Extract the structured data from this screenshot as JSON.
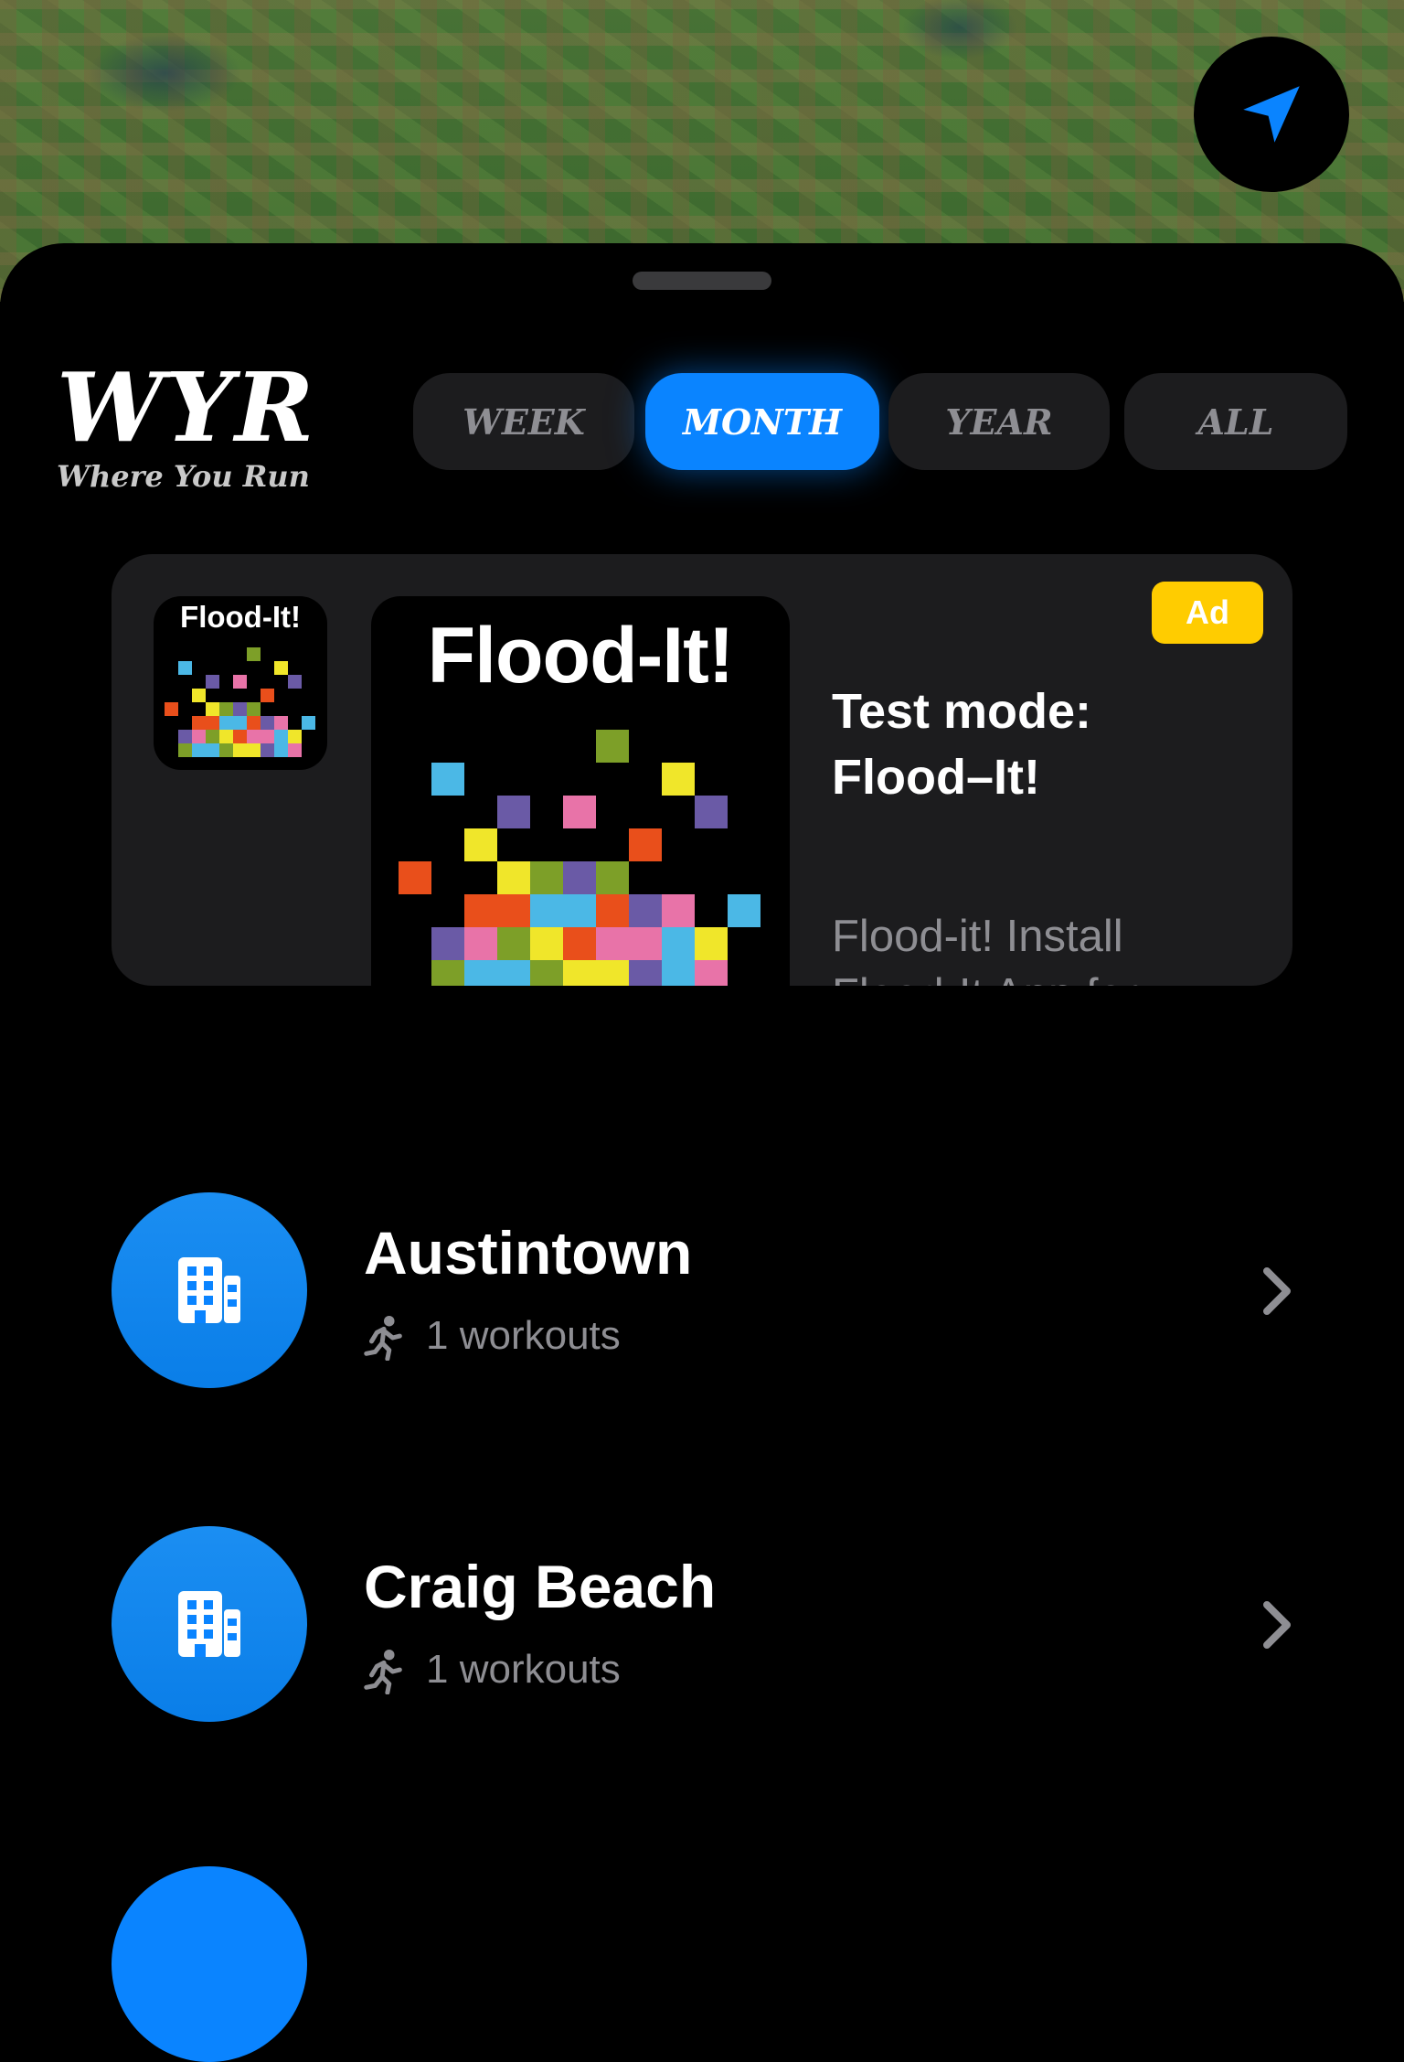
{
  "colors": {
    "accent": "#0a84ff",
    "sheet": "#000000",
    "card": "#1c1c1e",
    "badge": "#ffcc00"
  },
  "map": {
    "locate_icon": "location-arrow-icon"
  },
  "header": {
    "title": "WYR",
    "subtitle": "Where You Run",
    "segments": [
      {
        "label": "WEEK",
        "active": false
      },
      {
        "label": "MONTH",
        "active": true
      },
      {
        "label": "YEAR",
        "active": false
      },
      {
        "label": "ALL",
        "active": false
      }
    ]
  },
  "ad": {
    "icon_title": "Flood-It!",
    "image_title": "Flood-It!",
    "badge": "Ad",
    "headline": "Test mode: Flood–It!",
    "body": "Flood-it! Install Flood-It App for..."
  },
  "locations": [
    {
      "name": "Austintown",
      "count_text": "1 workouts",
      "icon": "building-icon"
    },
    {
      "name": "Craig Beach",
      "count_text": "1 workouts",
      "icon": "building-icon"
    }
  ]
}
